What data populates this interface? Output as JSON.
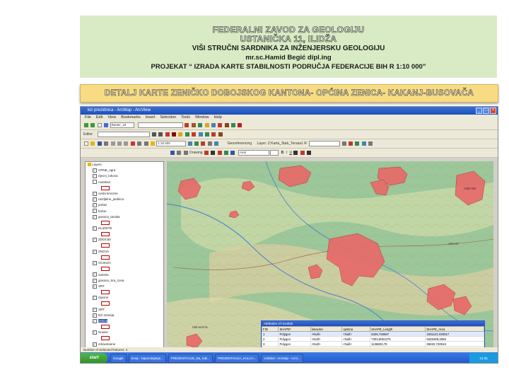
{
  "header": {
    "line1": "FEDERALNI ZAVOD ZA GEOLOGIJU",
    "line2": "USTANIČKA 11, ILIDŽA",
    "line3": "VIŠI STRUČNI SARDNIKA ZA INŽENJERSKU GEOLOGIJU",
    "line4": "mr.sc.Hamid Begić dipl.ing",
    "line5": "PROJEKAT “ IZRADA KARTE STABILNOSTI PODRUČJA FEDERACIJE BIH R 1:10 000”"
  },
  "banner": "DETALJ KARTE ZENIČKO DOBOJSKOG KANTONA- OPĆINA ZENICA- KAKANJ-BUSOVAČA",
  "window": {
    "title": "kiz prezidnica - ArcMap - ArcView",
    "menu": [
      "File",
      "Edit",
      "View",
      "Bookmarks",
      "Insert",
      "Selection",
      "Tools",
      "Window",
      "Help"
    ],
    "toolbar_fields": {
      "layer_combo": "Raster_18",
      "scale": "1:16 000",
      "georeferencing": "Georeferencing",
      "layer": "Layer: Z:Karta_Stab_Terasa1 R",
      "font": "Arial",
      "editor": "Editor",
      "drawing": "Drawing"
    },
    "toc": {
      "root": "Layers",
      "items": [
        {
          "label": "CRNE_ogra",
          "checked": true
        },
        {
          "label": "rijecni_tokova",
          "checked": true
        },
        {
          "label": "rovteksti",
          "checked": false
        },
        {
          "label": "",
          "checked": false
        },
        {
          "label": "cesta kmozne",
          "checked": true
        },
        {
          "label": "razdjelne_jedinica",
          "checked": true
        },
        {
          "label": "prelaz",
          "checked": true
        },
        {
          "label": "brdoe",
          "checked": true
        },
        {
          "label": "granica_tacaka",
          "checked": true
        },
        {
          "label": "",
          "checked": false
        },
        {
          "label": "KLIZISTE",
          "checked": true
        },
        {
          "label": "",
          "checked": false
        },
        {
          "label": "ZDOC60",
          "checked": true
        },
        {
          "label": "",
          "checked": false
        },
        {
          "label": "ZNOVA",
          "checked": true
        },
        {
          "label": "",
          "checked": false
        },
        {
          "label": "OCIKIZA",
          "checked": true
        },
        {
          "label": "",
          "checked": false
        },
        {
          "label": "varenie",
          "checked": true
        },
        {
          "label": "granica_Sra_zona",
          "checked": true
        },
        {
          "label": "SRT",
          "checked": true
        },
        {
          "label": "",
          "checked": false
        },
        {
          "label": "Opcine",
          "checked": true
        },
        {
          "label": "",
          "checked": false
        },
        {
          "label": "SRT",
          "checked": true
        },
        {
          "label": "kizl zemeja",
          "checked": true
        },
        {
          "label": "zenica",
          "checked": true,
          "selected": true
        },
        {
          "label": "",
          "checked": false
        },
        {
          "label": "Nosive",
          "checked": true
        },
        {
          "label": "",
          "checked": false
        },
        {
          "label": "zdravstvene",
          "checked": true
        },
        {
          "label": "",
          "checked": false
        },
        {
          "label": "Slike__1_IF",
          "checked": true
        },
        {
          "label": "slika_2_5_4",
          "checked": true
        },
        {
          "label": "slika_3_5_4",
          "checked": true
        }
      ],
      "tabs": [
        "Display",
        "Source",
        "Selection"
      ]
    },
    "attributes": {
      "title": "Attributes of rezultati",
      "columns": [
        "FID",
        "SHAPE*",
        "lokacitet",
        "opstina",
        "SHAPE_Length",
        "SHAPE_Area"
      ],
      "rows": [
        [
          "1",
          "Polygon",
          "<Null>",
          "<Null>",
          "6326,726667",
          "1931121.020017"
        ],
        [
          "2",
          "Polygon",
          "<Null>",
          "<Null>",
          "7303,6051275",
          "6329499,4659"
        ],
        [
          "3",
          "Polygon",
          "<Null>",
          "<Null>",
          "1138803,79",
          "35020,720519"
        ],
        [
          "4",
          "Polygon",
          "<Null>",
          "<Null>",
          "2751,39180",
          "1181488,19819"
        ]
      ]
    },
    "map_labels": [
      "UBI-M-KAL",
      "BRS-101",
      "ANJ-27",
      "ANE-NN"
    ],
    "status": "Number of Selected features: 4",
    "taskbar": {
      "start": "start",
      "tasks": [
        "Google",
        "Zmaj - Napominjanje...",
        "PREZENTACIJE_Ba_Kali...",
        "PREZENTACIJA_KALCA...",
        "Untitled - ArcMap - ArcV..."
      ],
      "clock": "12:35"
    }
  },
  "colors": {
    "header_bg": "#d9ebc4",
    "banner_bg": "#f7dc83",
    "map_green": "#9bc79a",
    "landslide_red": "#e86a6a",
    "taskbar_blue": "#2a63d6"
  }
}
